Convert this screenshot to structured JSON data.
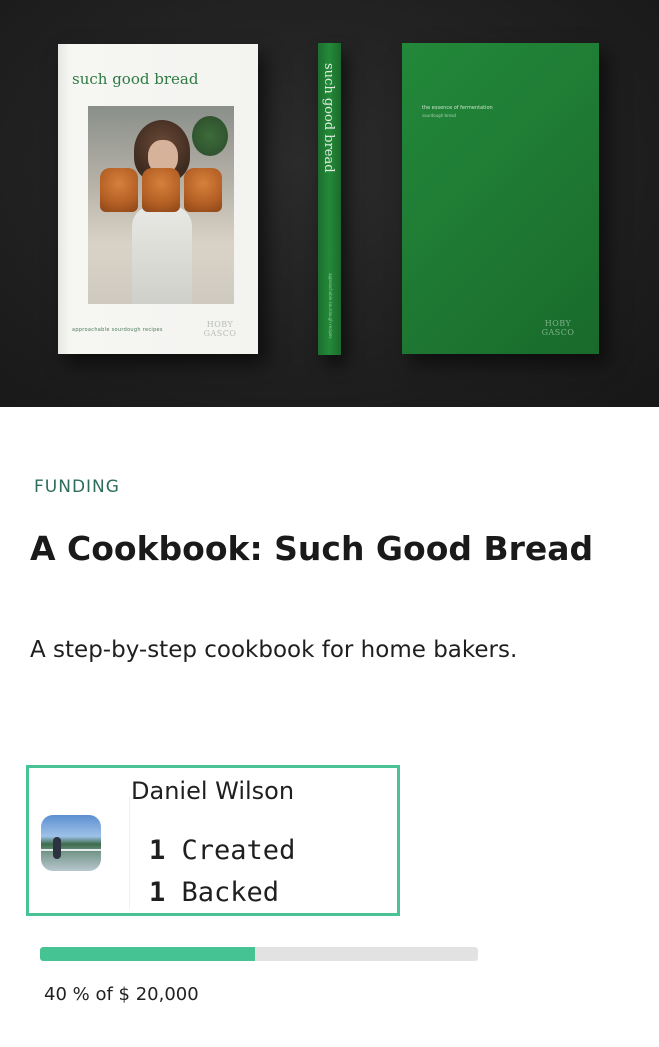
{
  "hero": {
    "cover_title": "such good bread",
    "cover_tagline": "approachable sourdough recipes",
    "spine_title": "such good bread",
    "publisher_logo": "HOBY GASCO",
    "back_cover_line1": "the essence of fermentation",
    "back_cover_line2": "sourdough bread"
  },
  "project": {
    "category": "FUNDING",
    "title": "A Cookbook: Such Good Bread",
    "blurb": "A step-by-step cookbook for home bakers."
  },
  "creator": {
    "name": "Daniel Wilson",
    "avatar_icon": "lakeside-photo-avatar",
    "created_count": "1",
    "created_label": "Created",
    "backed_count": "1",
    "backed_label": "Backed",
    "highlight_color": "#49c296"
  },
  "funding": {
    "percent": 40,
    "text": "40 % of $ 20,000",
    "progress_fraction": 0.49,
    "bar_color": "#45c393",
    "track_color": "#e2e2e2"
  }
}
